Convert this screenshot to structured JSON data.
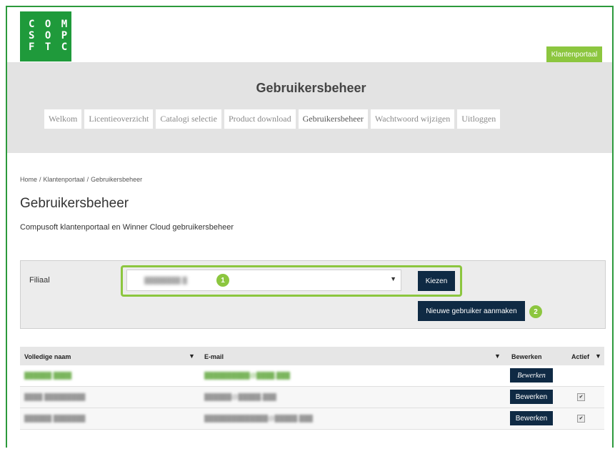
{
  "logo": {
    "rows": [
      "C O M",
      "S O P",
      "F T C"
    ]
  },
  "header": {
    "portal_button": "Klantenportaal"
  },
  "banner": {
    "title": "Gebruikersbeheer",
    "nav": [
      "Welkom",
      "Licentieoverzicht",
      "Catalogi selectie",
      "Product download",
      "Gebruikersbeheer",
      "Wachtwoord wijzigen",
      "Uitloggen"
    ],
    "active": "Gebruikersbeheer"
  },
  "breadcrumb": [
    "Home",
    "Klantenportaal",
    "Gebruikersbeheer"
  ],
  "breadcrumb_sep": "/",
  "page": {
    "title": "Gebruikersbeheer",
    "subtitle": "Compusoft klantenportaal en Winner Cloud gebruikersbeheer"
  },
  "filter": {
    "label": "Filiaal",
    "selected_value": "████████ █",
    "choose_button": "Kiezen",
    "new_user_button": "Nieuwe gebruiker aanmaken",
    "badge_1": "1",
    "badge_2": "2"
  },
  "table": {
    "headers": [
      "Volledige naam",
      "E-mail",
      "Bewerken",
      "Actief"
    ],
    "edit_label": "Bewerken",
    "rows": [
      {
        "name": "██████ ████",
        "email": "██████████@████.███",
        "active": null
      },
      {
        "name": "████ █████████",
        "email": "██████@█████.███",
        "active": true
      },
      {
        "name": "██████ ███████",
        "email": "██████████████@█████.███",
        "active": true
      }
    ]
  },
  "colors": {
    "brand_green": "#1f9a3b",
    "accent_green": "#8cc63f",
    "button_navy": "#0f2a44"
  }
}
